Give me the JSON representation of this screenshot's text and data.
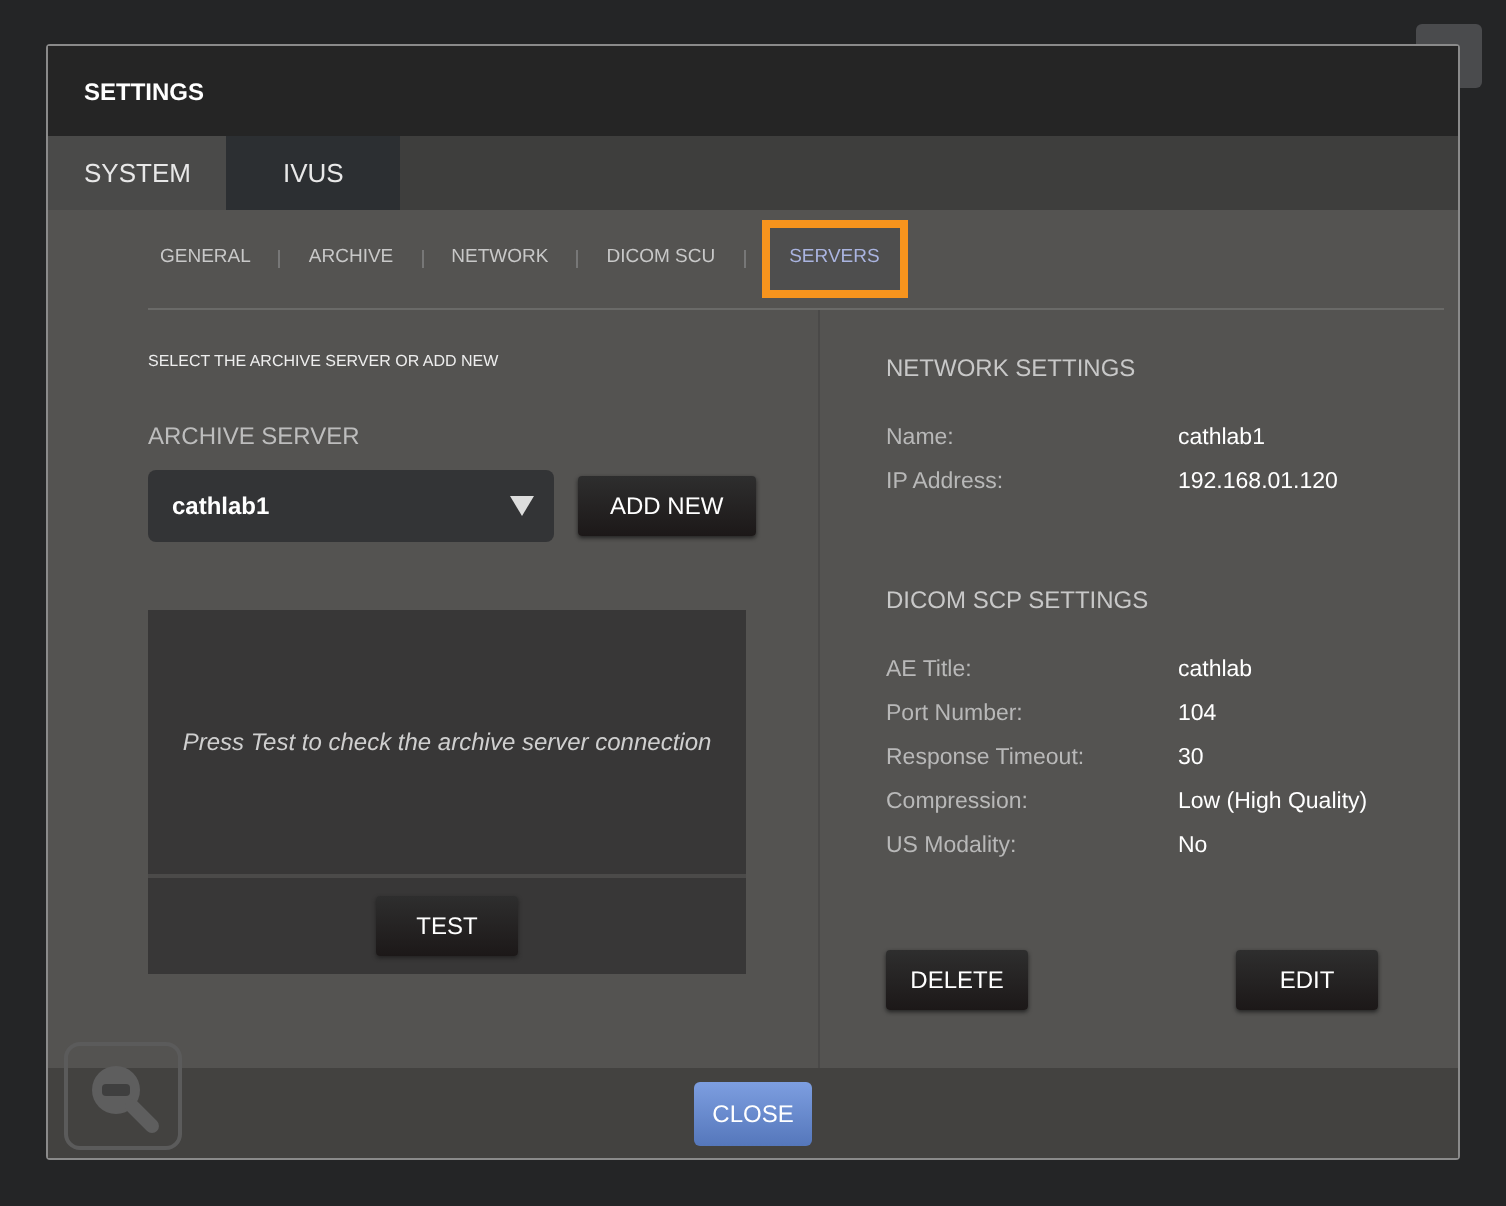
{
  "dialog": {
    "title": "SETTINGS"
  },
  "tabs": [
    {
      "label": "SYSTEM",
      "selected": false
    },
    {
      "label": "IVUS",
      "selected": true
    }
  ],
  "subtabs": [
    {
      "label": "GENERAL",
      "selected": false
    },
    {
      "label": "ARCHIVE",
      "selected": false
    },
    {
      "label": "NETWORK",
      "selected": false
    },
    {
      "label": "DICOM SCU",
      "selected": false
    },
    {
      "label": "SERVERS",
      "selected": true
    }
  ],
  "left": {
    "instruction": "SELECT THE ARCHIVE SERVER OR ADD NEW",
    "label": "ARCHIVE SERVER",
    "select_value": "cathlab1",
    "add_button": "ADD NEW",
    "message": "Press Test to check the archive server connection",
    "test_button": "TEST"
  },
  "network_settings": {
    "heading": "NETWORK SETTINGS",
    "rows": [
      {
        "label": "Name:",
        "value": "cathlab1"
      },
      {
        "label": "IP Address:",
        "value": "192.168.01.120"
      }
    ]
  },
  "dicom_settings": {
    "heading": "DICOM SCP SETTINGS",
    "rows": [
      {
        "label": "AE Title:",
        "value": "cathlab"
      },
      {
        "label": "Port Number:",
        "value": "104"
      },
      {
        "label": "Response Timeout:",
        "value": "30"
      },
      {
        "label": "Compression:",
        "value": "Low  (High Quality)"
      },
      {
        "label": "US Modality:",
        "value": "No"
      }
    ]
  },
  "actions": [
    "DELETE",
    "EDIT"
  ],
  "footer": {
    "close_button": "CLOSE"
  }
}
